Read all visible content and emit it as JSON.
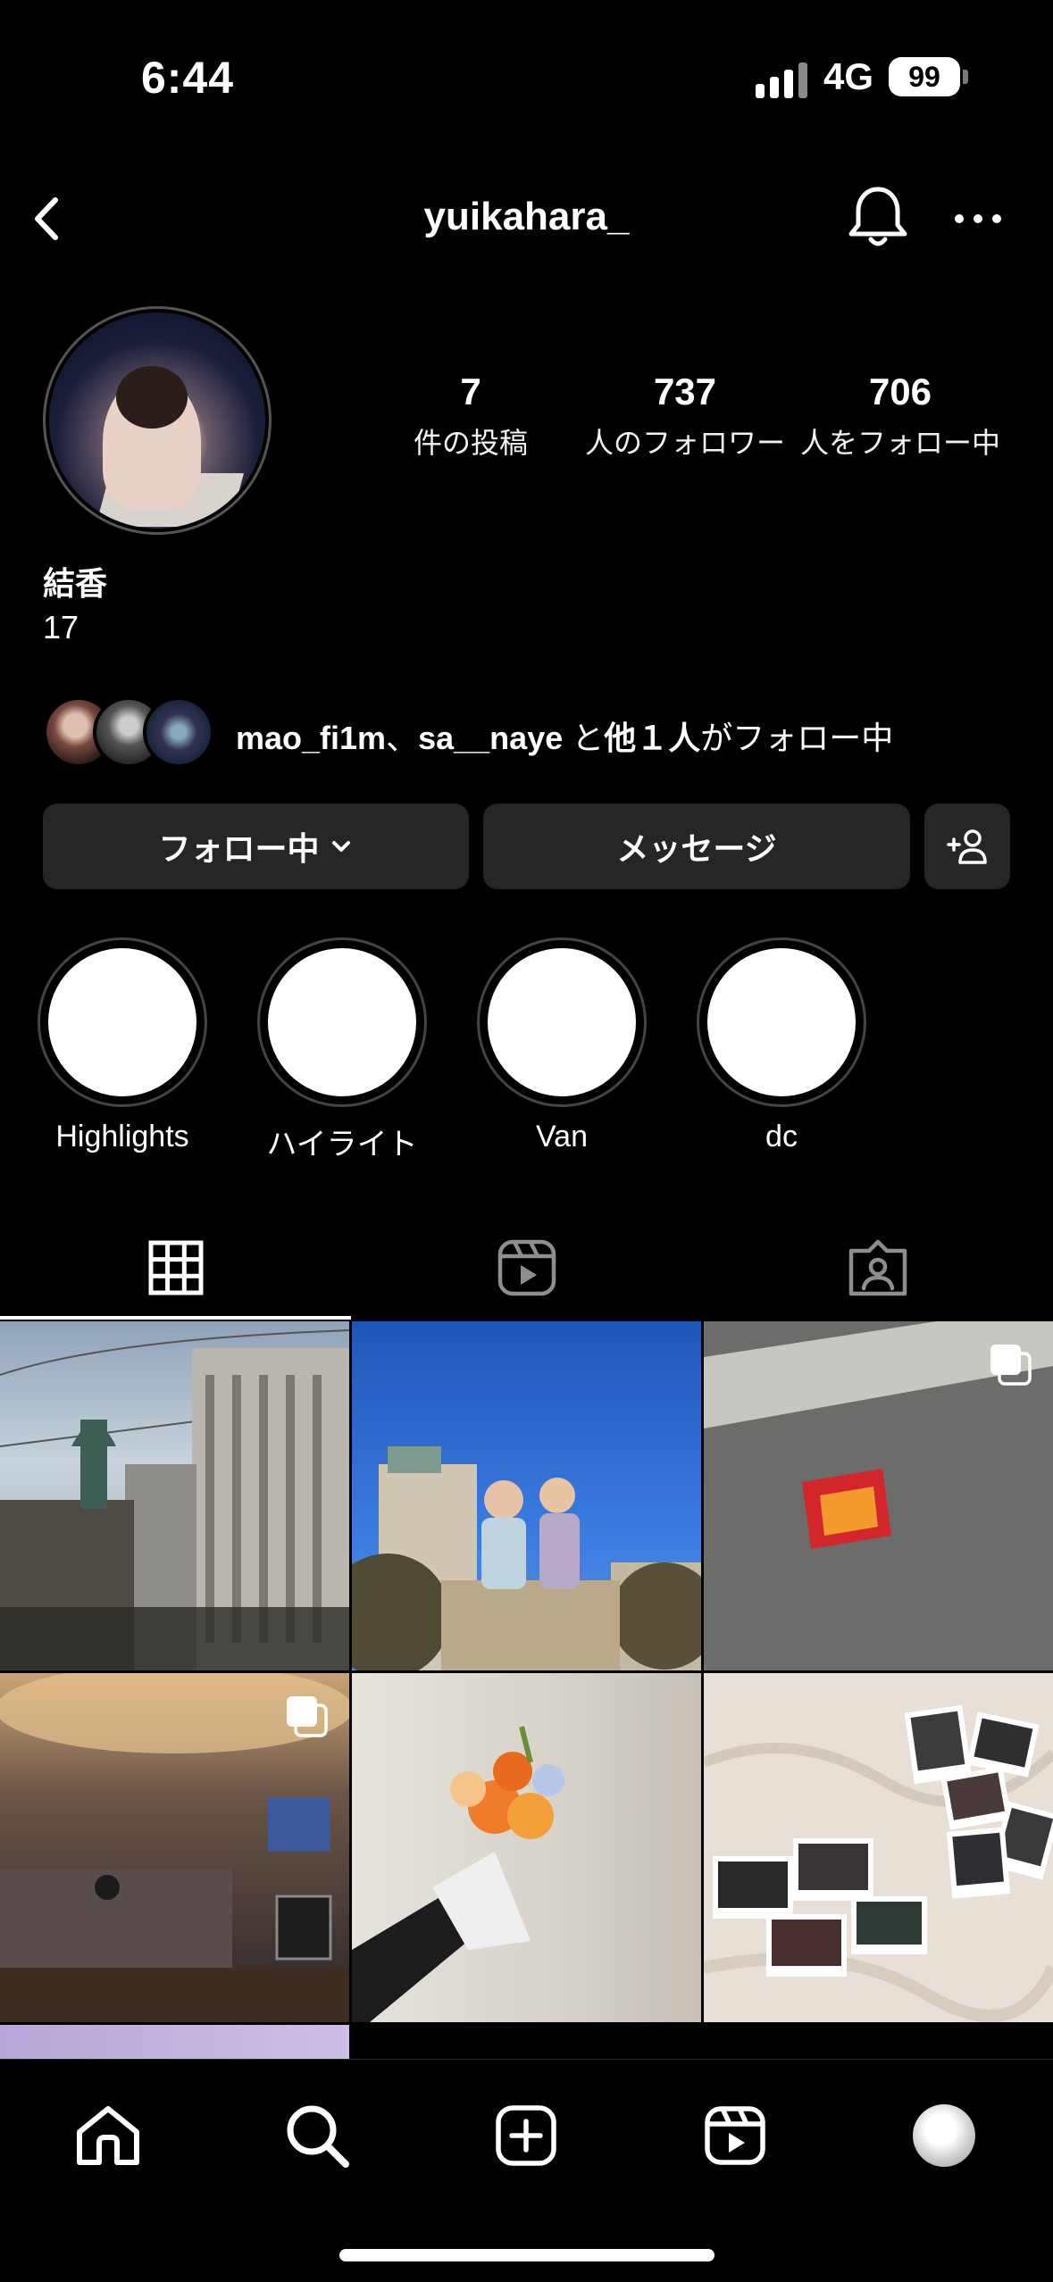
{
  "status_bar": {
    "time": "6:44",
    "network": "4G",
    "battery": "99"
  },
  "header": {
    "username": "yuikahara_"
  },
  "profile": {
    "stats": [
      {
        "value": "7",
        "label": "件の投稿"
      },
      {
        "value": "737",
        "label": "人のフォロワー"
      },
      {
        "value": "706",
        "label": "人をフォロー中"
      }
    ],
    "display_name": "結香",
    "bio": "17",
    "followed_by": {
      "user1": "mao_fi1m",
      "sep": "、",
      "user2": "sa__naye",
      "mid": "と",
      "others": "他１人",
      "suffix": "がフォロー中"
    }
  },
  "buttons": {
    "following": "フォロー中",
    "message": "メッセージ"
  },
  "highlights": [
    {
      "label": "Highlights"
    },
    {
      "label": "ハイライト"
    },
    {
      "label": "Van"
    },
    {
      "label": "dc"
    }
  ],
  "tabs": [
    "grid-icon",
    "reels-icon",
    "tagged-icon"
  ],
  "posts": [
    {
      "subject": "city buildings",
      "multi": false
    },
    {
      "subject": "friends on tree stump",
      "multi": false
    },
    {
      "subject": "box on asphalt",
      "multi": true
    },
    {
      "subject": "restaurant interior",
      "multi": true
    },
    {
      "subject": "flower bouquet",
      "multi": false
    },
    {
      "subject": "photos on bed",
      "multi": false
    }
  ],
  "bottom_nav": [
    "home-icon",
    "search-icon",
    "create-icon",
    "reels-icon",
    "profile-avatar"
  ]
}
